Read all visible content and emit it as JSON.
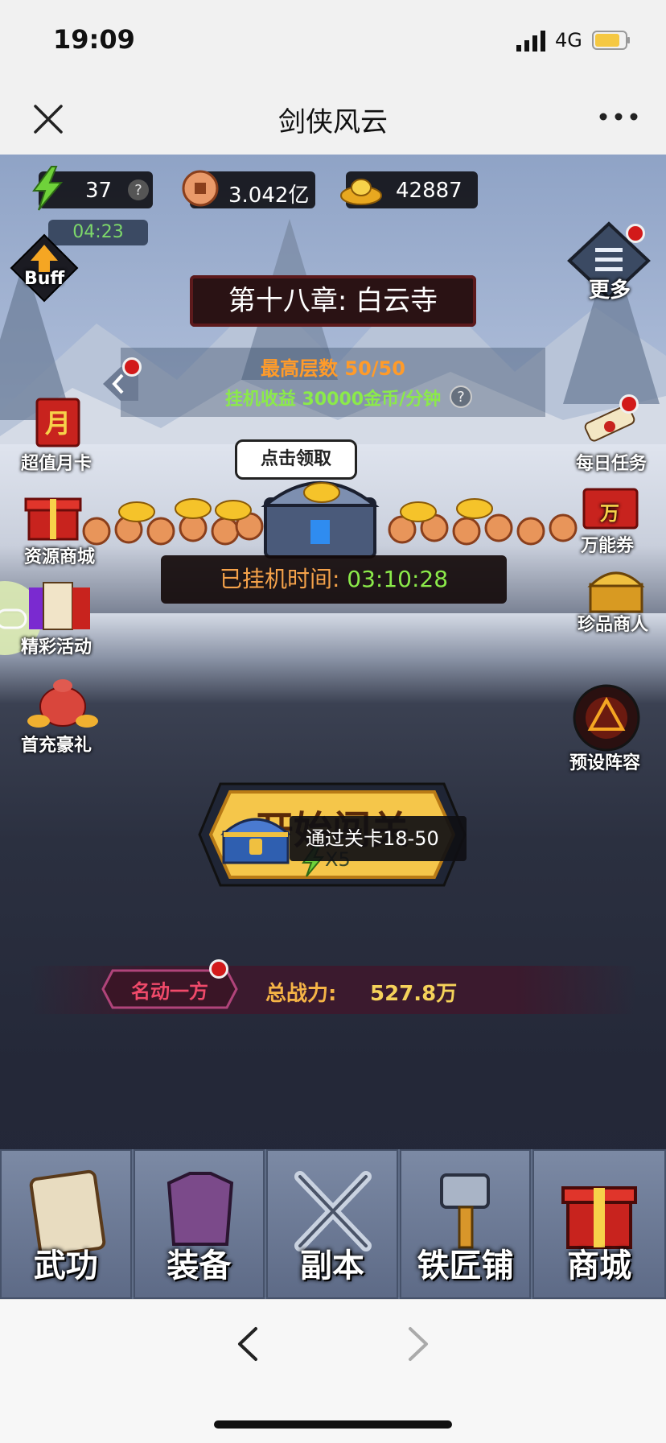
{
  "status": {
    "time": "19:09",
    "network": "4G"
  },
  "nav": {
    "title": "剑侠风云"
  },
  "resources": {
    "energy": "37",
    "energy_timer": "04:23",
    "copper": "3.042亿",
    "gold": "42887"
  },
  "left_menu": {
    "buff": "Buff",
    "monthly_card": "超值月卡",
    "resource_shop": "资源商城",
    "events": "精彩活动",
    "first_recharge": "首充豪礼"
  },
  "right_menu": {
    "more": "更多",
    "daily_tasks": "每日任务",
    "voucher": "万能券",
    "treasure_merchant": "珍品商人",
    "preset_lineup": "预设阵容",
    "voucher_icon_char": "万"
  },
  "stage": {
    "chapter": "第十八章: 白云寺",
    "max_floor": "最高层数 50/50",
    "idle_income": "挂机收益 30000金币/分钟",
    "claim_bubble": "点击领取",
    "idle_time_label": "已挂机时间:",
    "idle_time_value": "03:10:28"
  },
  "start": {
    "label": "开始闯关",
    "cost": "X5"
  },
  "pass": {
    "text": "通过关卡18-50"
  },
  "power": {
    "title": "名动一方",
    "label": "总战力:",
    "value": "527.8万"
  },
  "tabs": [
    "武功",
    "装备",
    "副本",
    "铁匠铺",
    "商城"
  ],
  "colors": {
    "badge": "#d21a1a",
    "accent_green": "#8bea4a",
    "accent_orange": "#ff9b2a"
  }
}
